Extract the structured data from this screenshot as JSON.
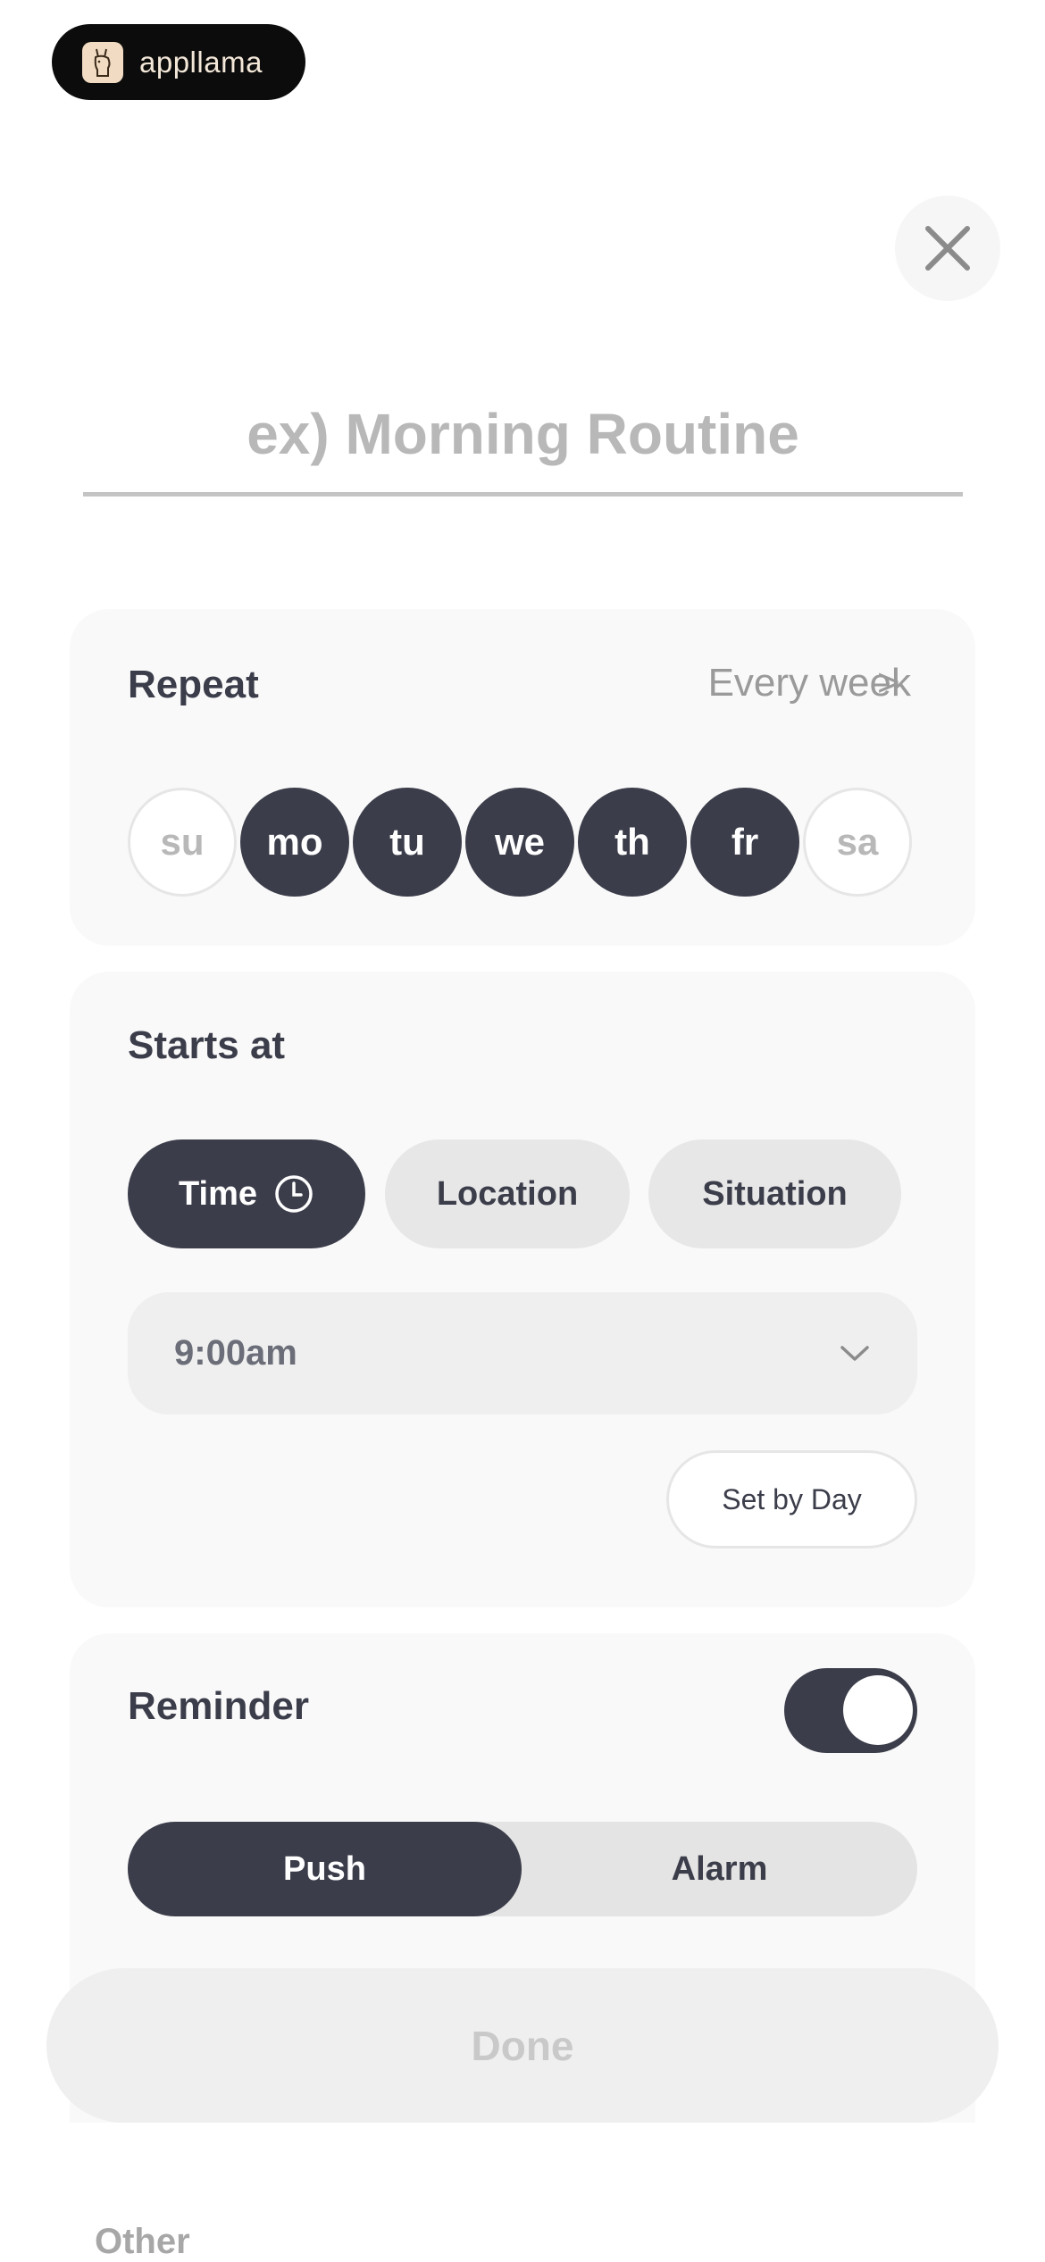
{
  "brand": {
    "name": "appllama"
  },
  "title_field": {
    "placeholder": "ex) Morning Routine",
    "value": ""
  },
  "repeat": {
    "label": "Repeat",
    "frequency": "Every week",
    "chevron": ">",
    "days": [
      {
        "label": "su",
        "selected": false
      },
      {
        "label": "mo",
        "selected": true
      },
      {
        "label": "tu",
        "selected": true
      },
      {
        "label": "we",
        "selected": true
      },
      {
        "label": "th",
        "selected": true
      },
      {
        "label": "fr",
        "selected": true
      },
      {
        "label": "sa",
        "selected": false
      }
    ]
  },
  "starts_at": {
    "label": "Starts at",
    "options": [
      {
        "label": "Time",
        "icon": "clock-icon",
        "selected": true
      },
      {
        "label": "Location",
        "selected": false
      },
      {
        "label": "Situation",
        "selected": false
      }
    ],
    "time_value": "9:00am",
    "set_by_day_label": "Set by Day"
  },
  "reminder": {
    "label": "Reminder",
    "enabled": true,
    "modes": [
      {
        "label": "Push",
        "selected": true
      },
      {
        "label": "Alarm",
        "selected": false
      }
    ]
  },
  "done_label": "Done",
  "other_label": "Other",
  "colors": {
    "primary": "#3b3d4a",
    "card_background": "#f9f9f9",
    "placeholder": "#b8b8b8",
    "muted": "#9a9a9a"
  }
}
